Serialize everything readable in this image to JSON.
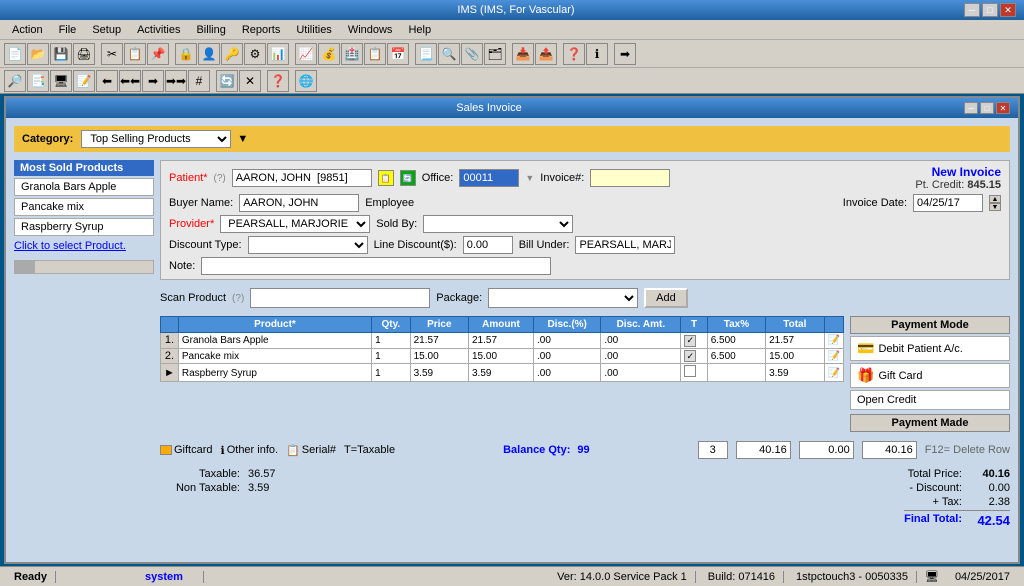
{
  "window": {
    "title": "IMS (IMS, For Vascular)",
    "inner_title": "Sales Invoice"
  },
  "menu": {
    "items": [
      "Action",
      "File",
      "Setup",
      "Activities",
      "Billing",
      "Reports",
      "Utilities",
      "Windows",
      "Help"
    ]
  },
  "category": {
    "label": "Category:",
    "value": "Top Selling Products"
  },
  "left_panel": {
    "title": "Most Sold Products",
    "items": [
      "Granola Bars Apple",
      "Pancake mix",
      "Raspberry Syrup"
    ]
  },
  "form": {
    "patient_label": "Patient*",
    "patient_hint": "(?)",
    "patient_value": "AARON, JOHN  [9851]",
    "office_label": "Office:",
    "office_value": "00011",
    "invoice_label": "Invoice#:",
    "invoice_value": "",
    "new_invoice": "New Invoice",
    "pt_credit_label": "Pt. Credit:",
    "pt_credit_value": "845.15",
    "buyer_label": "Buyer Name:",
    "buyer_value": "AARON, JOHN",
    "employee_label": "Employee",
    "invoice_date_label": "Invoice Date:",
    "invoice_date_value": "04/25/17",
    "provider_label": "Provider*",
    "provider_value": "PEARSALL, MARJORIE",
    "sold_by_label": "Sold By:",
    "sold_by_value": "",
    "discount_label": "Discount Type:",
    "discount_value": "",
    "line_discount_label": "Line Discount($):",
    "line_discount_value": "0.00",
    "bill_under_label": "Bill Under:",
    "bill_under_value": "PEARSALL, MARJO",
    "note_label": "Note:"
  },
  "scan": {
    "label": "Scan Product",
    "hint": "(?)",
    "package_label": "Package:",
    "add_label": "Add"
  },
  "table": {
    "headers": [
      "Product*",
      "Qty.",
      "Price",
      "Amount",
      "Disc.(%)",
      "Disc. Amt.",
      "T",
      "Tax%",
      "Total",
      ""
    ],
    "rows": [
      {
        "num": "1.",
        "product": "Granola Bars Apple",
        "qty": "1",
        "price": "21.57",
        "amount": "21.57",
        "disc_pct": ".00",
        "disc_amt": ".00",
        "taxable": true,
        "tax_pct": "6.500",
        "total": "21.57"
      },
      {
        "num": "2.",
        "product": "Pancake mix",
        "qty": "1",
        "price": "15.00",
        "amount": "15.00",
        "disc_pct": ".00",
        "disc_amt": ".00",
        "taxable": true,
        "tax_pct": "6.500",
        "total": "15.00"
      },
      {
        "num": "►",
        "product": "Raspberry Syrup",
        "qty": "1",
        "price": "3.59",
        "amount": "3.59",
        "disc_pct": ".00",
        "disc_amt": ".00",
        "taxable": false,
        "tax_pct": "",
        "total": "3.59"
      }
    ]
  },
  "balance": {
    "label": "Balance Qty:",
    "value": "99"
  },
  "totals_row": {
    "qty_total": "3",
    "amount_total": "40.16",
    "discount_total": "0.00",
    "total": "40.16"
  },
  "footnotes": [
    {
      "icon": "gc",
      "label": "Giftcard"
    },
    {
      "icon": "info",
      "label": "Other info."
    },
    {
      "icon": "serial",
      "label": "Serial#"
    },
    {
      "label": "T=Taxable"
    }
  ],
  "delete_row": "F12= Delete Row",
  "summary": {
    "taxable_label": "Taxable:",
    "taxable_value": "36.57",
    "non_taxable_label": "Non Taxable:",
    "non_taxable_value": "3.59",
    "total_price_label": "Total Price:",
    "total_price_value": "40.16",
    "discount_label": "- Discount:",
    "discount_value": "0.00",
    "tax_label": "+ Tax:",
    "tax_value": "2.38",
    "final_total_label": "Final Total:",
    "final_total_value": "42.54"
  },
  "payment_mode": {
    "title": "Payment Mode",
    "items": [
      {
        "label": "Debit Patient A/c.",
        "icon": "💳"
      },
      {
        "label": "Gift Card",
        "icon": "🎁"
      },
      {
        "label": "Open Credit",
        "icon": ""
      }
    ],
    "payment_made_title": "Payment Made"
  },
  "click_product": "Click to select Product.",
  "status_bar": {
    "ready": "Ready",
    "system": "system",
    "version": "Ver: 14.0.0 Service Pack 1",
    "build": "Build: 071416",
    "install": "1stpctouch3 - 0050335",
    "date": "04/25/2017"
  }
}
